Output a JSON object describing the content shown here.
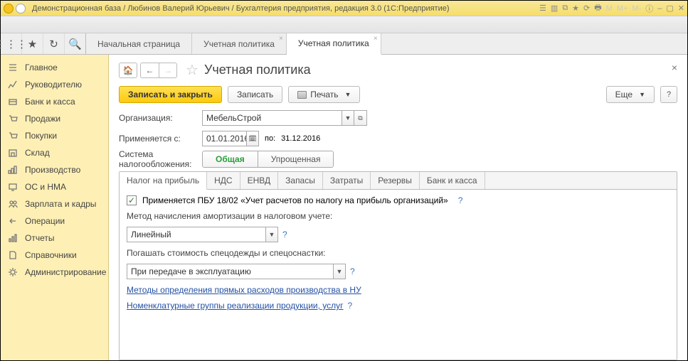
{
  "window": {
    "title": "Демонстрационная база / Любинов Валерий Юрьевич / Бухгалтерия предприятия, редакция 3.0  (1С:Предприятие)"
  },
  "pageTabs": {
    "start": "Начальная страница",
    "up1": "Учетная политика",
    "up2": "Учетная политика"
  },
  "sidebar": {
    "items": [
      "Главное",
      "Руководителю",
      "Банк и касса",
      "Продажи",
      "Покупки",
      "Склад",
      "Производство",
      "ОС и НМА",
      "Зарплата и кадры",
      "Операции",
      "Отчеты",
      "Справочники",
      "Администрирование"
    ]
  },
  "page": {
    "title": "Учетная политика"
  },
  "toolbar": {
    "writeClose": "Записать и закрыть",
    "write": "Записать",
    "print": "Печать",
    "more": "Еще"
  },
  "form": {
    "orgLabel": "Организация:",
    "orgValue": "МебельСтрой",
    "appliesLabel": "Применяется с:",
    "dateFrom": "01.01.2016",
    "toLabel": "по:",
    "dateTo": "31.12.2016",
    "taxSystemLabel": "Система налогообложения:",
    "taxGeneral": "Общая",
    "taxSimple": "Упрощенная"
  },
  "tabs": {
    "profit": "Налог на прибыль",
    "nds": "НДС",
    "envd": "ЕНВД",
    "stock": "Запасы",
    "costs": "Затраты",
    "reserves": "Резервы",
    "bank": "Банк и касса"
  },
  "profitTab": {
    "pbu": "Применяется ПБУ 18/02 «Учет расчетов по налогу на прибыль организаций»",
    "amortLabel": "Метод начисления амортизации в налоговом учете:",
    "amortValue": "Линейный",
    "spetsLabel": "Погашать стоимость спецодежды и спецоснастки:",
    "spetsValue": "При передаче в эксплуатацию",
    "link1": "Методы определения прямых расходов производства в НУ",
    "link2": "Номенклатурные группы реализации продукции, услуг"
  }
}
